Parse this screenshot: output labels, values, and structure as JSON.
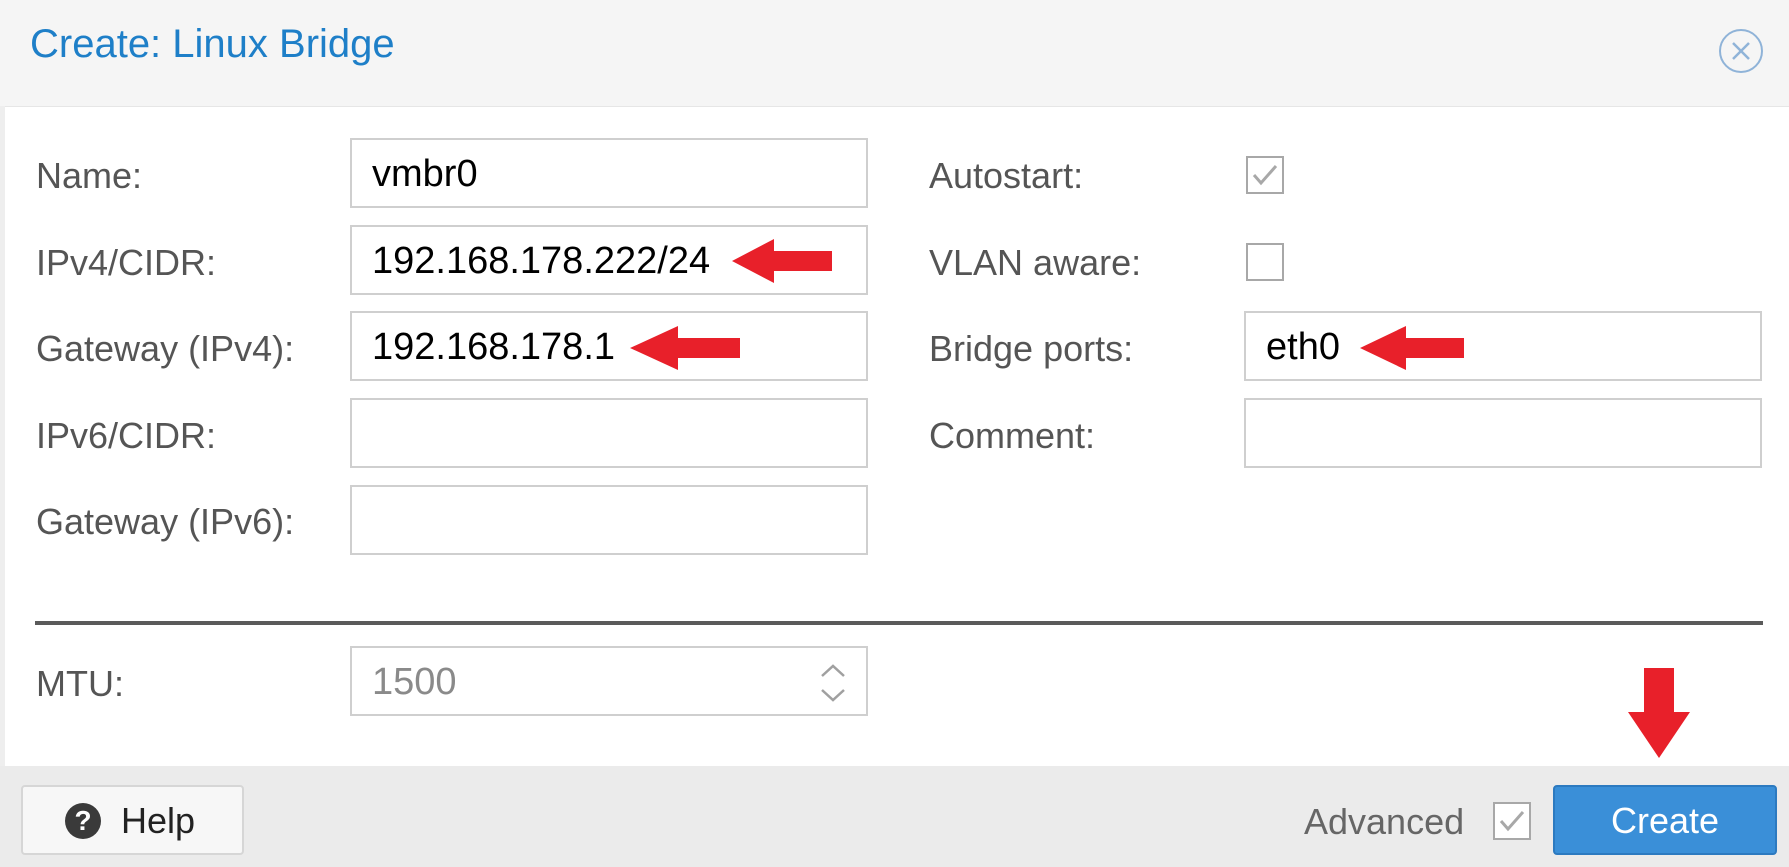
{
  "dialog": {
    "title": "Create: Linux Bridge"
  },
  "form": {
    "name": {
      "label": "Name:",
      "value": "vmbr0"
    },
    "ipv4": {
      "label": "IPv4/CIDR:",
      "value": "192.168.178.222/24"
    },
    "gateway_ipv4": {
      "label": "Gateway (IPv4):",
      "value": "192.168.178.1"
    },
    "ipv6": {
      "label": "IPv6/CIDR:",
      "value": ""
    },
    "gateway_ipv6": {
      "label": "Gateway (IPv6):",
      "value": ""
    },
    "autostart": {
      "label": "Autostart:",
      "checked": true
    },
    "vlan_aware": {
      "label": "VLAN aware:",
      "checked": false
    },
    "bridge_ports": {
      "label": "Bridge ports:",
      "value": "eth0"
    },
    "comment": {
      "label": "Comment:",
      "value": ""
    },
    "mtu": {
      "label": "MTU:",
      "value": "1500"
    }
  },
  "footer": {
    "help_label": "Help",
    "help_icon": "?",
    "advanced_label": "Advanced",
    "advanced_checked": true,
    "create_label": "Create"
  },
  "colors": {
    "title": "#1e7fc8",
    "create_button": "#3a8fd8",
    "annotation_arrow": "#e8202a"
  },
  "icons": [
    "close-icon",
    "help-icon",
    "checkmark-icon",
    "spinner-icon",
    "arrow-icon"
  ]
}
